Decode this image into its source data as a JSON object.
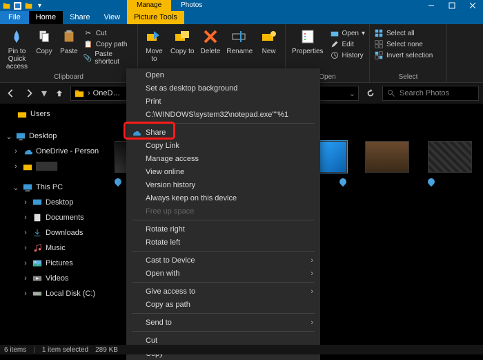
{
  "titlebar": {
    "manage_tab": "Manage",
    "photos_tab": "Photos"
  },
  "menu": {
    "file": "File",
    "home": "Home",
    "share": "Share",
    "view": "View",
    "picture_tools": "Picture Tools"
  },
  "ribbon": {
    "pin": "Pin to Quick access",
    "copy": "Copy",
    "paste": "Paste",
    "cut": "Cut",
    "copy_path": "Copy path",
    "paste_shortcut": "Paste shortcut",
    "clipboard": "Clipboard",
    "move": "Move to",
    "copy_to": "Copy to",
    "delete": "Delete",
    "rename": "Rename",
    "new": "New",
    "properties": "Properties",
    "open": "Open",
    "open_drop": "Open",
    "edit": "Edit",
    "history": "History",
    "select_all": "Select all",
    "select_none": "Select none",
    "invert": "Invert selection",
    "select": "Select"
  },
  "nav": {
    "breadcrumb": "OneD…",
    "refresh": "",
    "search_placeholder": "Search Photos"
  },
  "tree": {
    "users": "Users",
    "desktop": "Desktop",
    "onedrive": "OneDrive - Person",
    "thispc": "This PC",
    "desktop2": "Desktop",
    "documents": "Documents",
    "downloads": "Downloads",
    "music": "Music",
    "pictures": "Pictures",
    "videos": "Videos",
    "localdisk": "Local Disk (C:)"
  },
  "ctx": {
    "open": "Open",
    "set_bg": "Set as desktop background",
    "print": "Print",
    "notepad": "C:\\WINDOWS\\system32\\notepad.exe\"\"%1",
    "share": "Share",
    "copy_link": "Copy Link",
    "manage_access": "Manage access",
    "view_online": "View online",
    "version_history": "Version history",
    "always_keep": "Always keep on this device",
    "free_up": "Free up space",
    "rotate_right": "Rotate right",
    "rotate_left": "Rotate left",
    "cast": "Cast to Device",
    "open_with": "Open with",
    "give_access": "Give access to",
    "copy_as_path": "Copy as path",
    "send_to": "Send to",
    "cut": "Cut",
    "copy": "Copy"
  },
  "status": {
    "items": "6 items",
    "selected": "1 item selected",
    "size": "289 KB"
  }
}
